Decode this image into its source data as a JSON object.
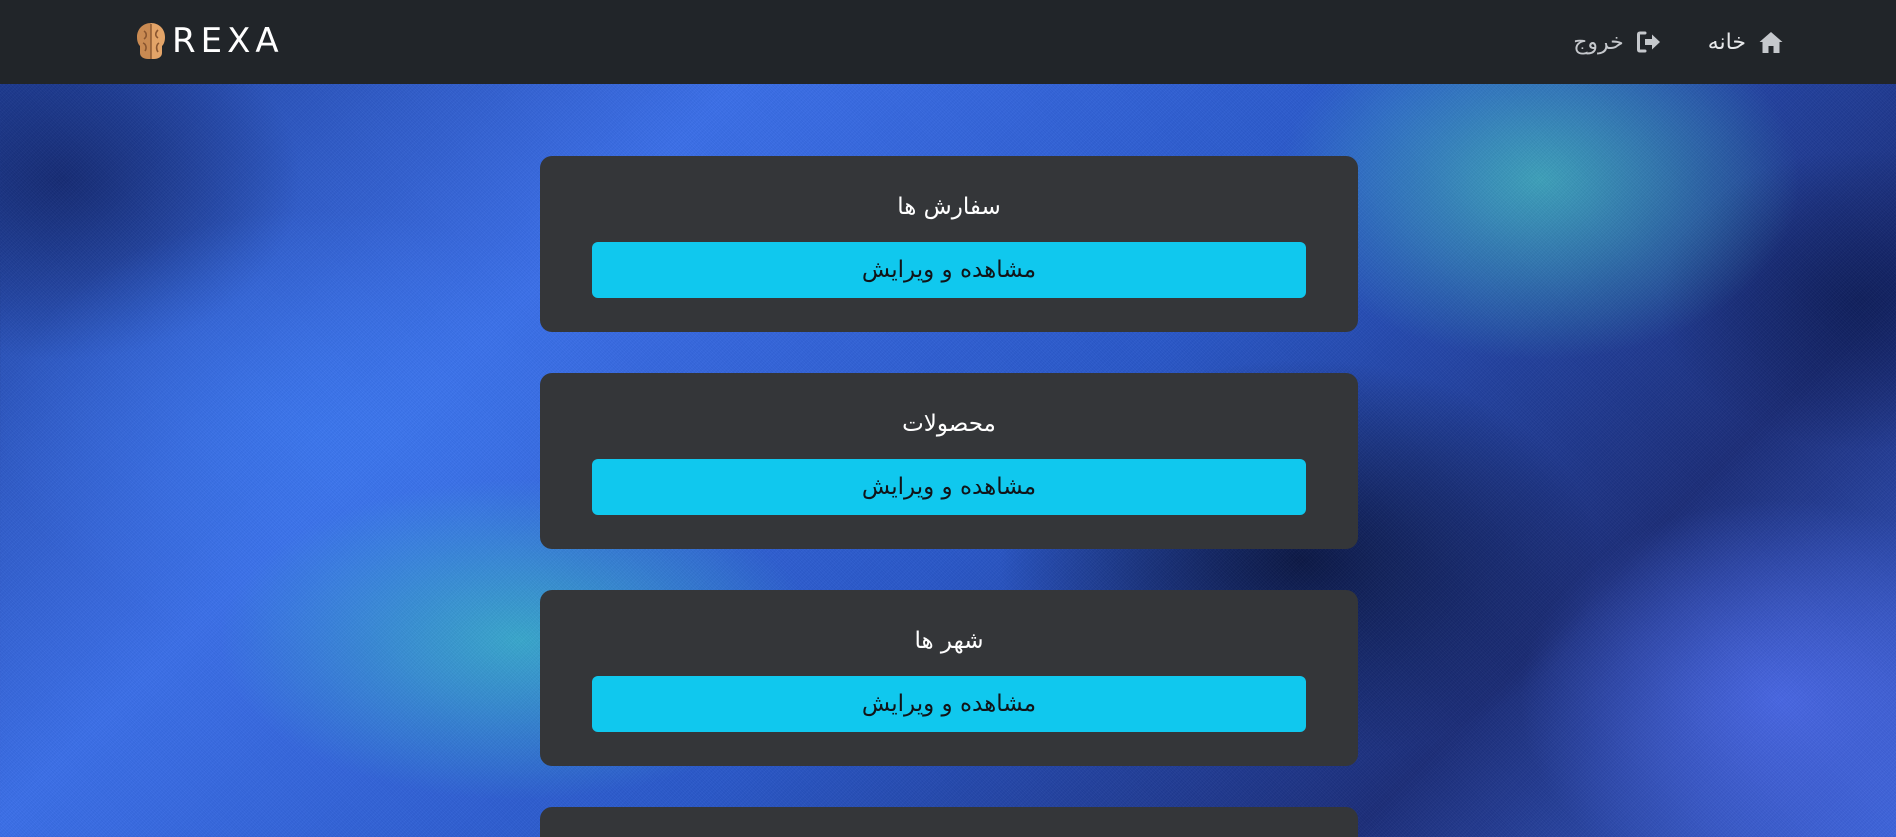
{
  "navbar": {
    "brand_name": "REXA",
    "brand_logo_icon": "brain-icon",
    "links": [
      {
        "label": "خانه",
        "icon": "home-icon"
      },
      {
        "label": "خروج",
        "icon": "sign-out-icon"
      }
    ]
  },
  "cards": [
    {
      "title": "سفارش ها",
      "button_label": "مشاهده و ویرایش"
    },
    {
      "title": "محصولات",
      "button_label": "مشاهده و ویرایش"
    },
    {
      "title": "شهر ها",
      "button_label": "مشاهده و ویرایش"
    }
  ],
  "colors": {
    "navbar_bg": "#212529",
    "card_bg": "#343639",
    "button_bg": "#10c8ee",
    "background_blue": "#3b6fe8"
  }
}
